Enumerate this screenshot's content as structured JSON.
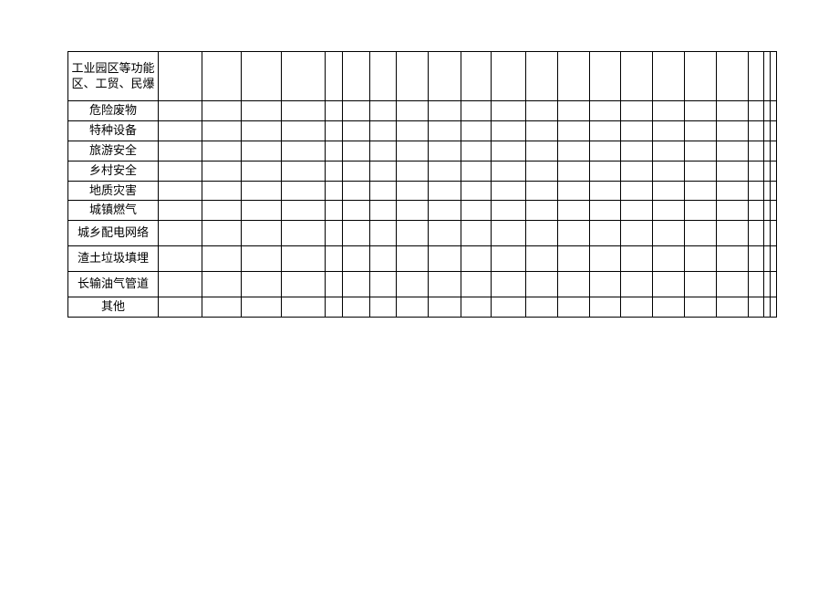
{
  "rows": [
    {
      "label": "工业园区等功能区、工贸、民爆",
      "hclass": "r-tall"
    },
    {
      "label": "危险废物",
      "hclass": "r-short"
    },
    {
      "label": "特种设备",
      "hclass": "r-short"
    },
    {
      "label": "旅游安全",
      "hclass": "r-short"
    },
    {
      "label": "乡村安全",
      "hclass": "r-short"
    },
    {
      "label": "地质灾害",
      "hclass": "r-short"
    },
    {
      "label": "城镇燃气",
      "hclass": "r-short"
    },
    {
      "label": "城乡配电网络",
      "hclass": "r-med"
    },
    {
      "label": "渣土垃圾填埋",
      "hclass": "r-med"
    },
    {
      "label": "长输油气管道",
      "hclass": "r-med"
    },
    {
      "label": "其他",
      "hclass": "r-short"
    }
  ],
  "col_count": 21,
  "col_classes": [
    "c1",
    "c2",
    "c3",
    "c4",
    "c5",
    "c6",
    "c7",
    "c8",
    "c9",
    "c10",
    "c11",
    "c12",
    "c13",
    "c14",
    "c15",
    "c16",
    "c17",
    "c18",
    "c19",
    "c20",
    "c21"
  ]
}
